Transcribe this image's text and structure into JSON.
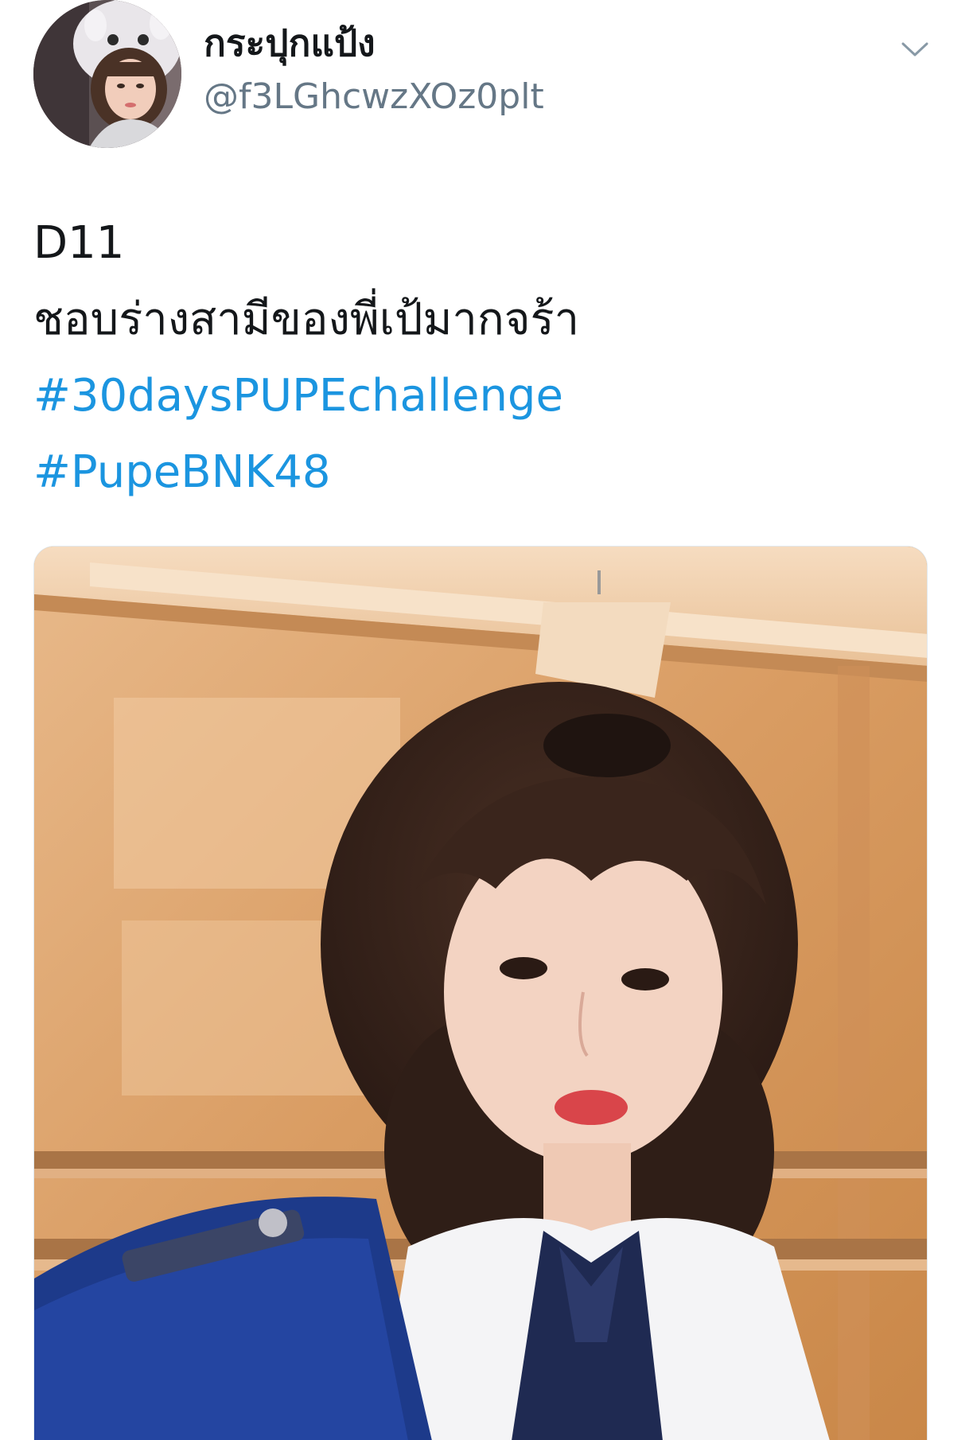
{
  "tweet": {
    "author": {
      "display_name": "กระปุกแป้ง",
      "handle": "@f3LGhcwzXOz0plt"
    },
    "text_lines": [
      "D11",
      "ชอบร่างสามีของพี่เป้มากจร้า"
    ],
    "hashtags": [
      "#30daysPUPEchallenge",
      "#PupeBNK48"
    ],
    "icons": {
      "menu": "chevron-down-icon"
    }
  },
  "colors": {
    "hashtag": "#1b95e0",
    "handle": "#657786",
    "text": "#14171a"
  }
}
